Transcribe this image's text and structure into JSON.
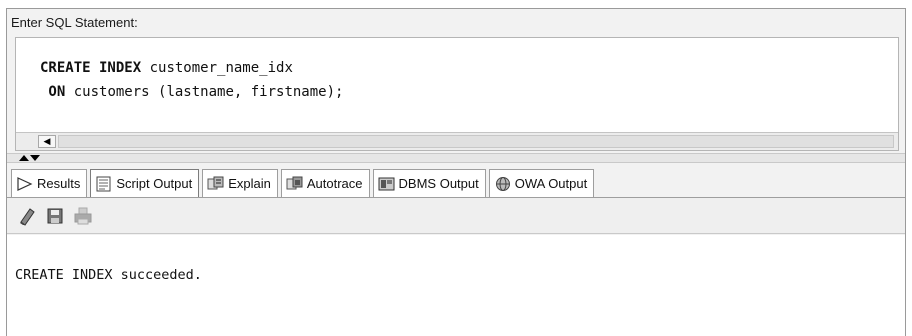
{
  "editor": {
    "label": "Enter SQL Statement:",
    "line1_kw": "CREATE INDEX",
    "line1_rest": " customer_name_idx",
    "line2_kw": " ON",
    "line2_rest": " customers (lastname, firstname);"
  },
  "tabs": [
    {
      "label": "Results",
      "icon": "play-icon"
    },
    {
      "label": "Script Output",
      "icon": "script-icon"
    },
    {
      "label": "Explain",
      "icon": "explain-icon"
    },
    {
      "label": "Autotrace",
      "icon": "autotrace-icon"
    },
    {
      "label": "DBMS Output",
      "icon": "dbms-icon"
    },
    {
      "label": "OWA Output",
      "icon": "owa-icon"
    }
  ],
  "active_tab": "Script Output",
  "toolbar": {
    "icons": [
      "eraser-icon",
      "save-icon",
      "print-icon"
    ]
  },
  "output": {
    "text": "CREATE INDEX succeeded."
  }
}
